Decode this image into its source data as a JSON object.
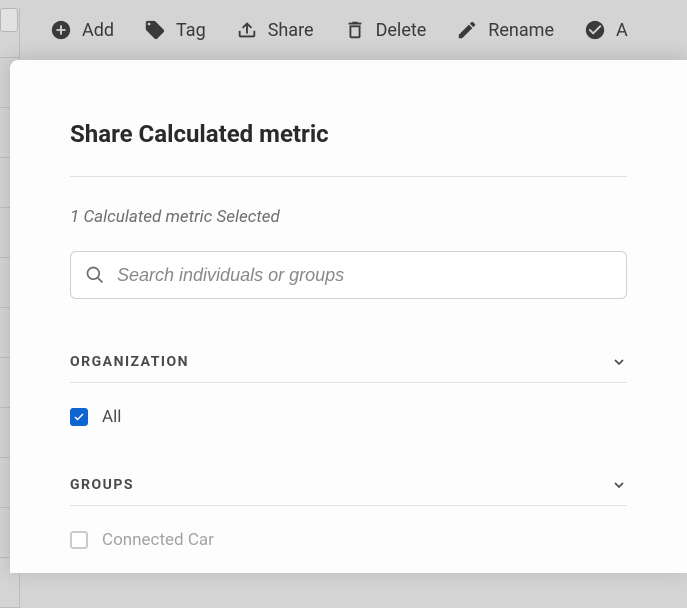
{
  "toolbar": {
    "add_label": "Add",
    "tag_label": "Tag",
    "share_label": "Share",
    "delete_label": "Delete",
    "rename_label": "Rename",
    "approve_label": "A"
  },
  "modal": {
    "title": "Share Calculated metric",
    "subtitle": "1 Calculated metric Selected",
    "search": {
      "placeholder": "Search individuals or groups"
    },
    "sections": {
      "organization": {
        "title": "ORGANIZATION",
        "items": [
          {
            "label": "All",
            "checked": true
          }
        ]
      },
      "groups": {
        "title": "GROUPS",
        "items": [
          {
            "label": "Connected Car",
            "checked": false
          }
        ]
      }
    }
  }
}
